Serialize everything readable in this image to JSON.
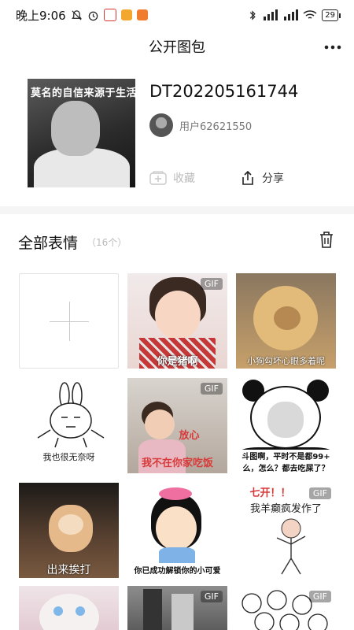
{
  "status": {
    "time": "晚上9:06",
    "battery": "29",
    "net1": "HD",
    "net2": "HD"
  },
  "header": {
    "title": "公开图包",
    "more": "···"
  },
  "pack": {
    "cover_caption": "莫名的自信来源于生活",
    "name": "DT202205161744",
    "user": "用户62621550",
    "favorite_label": "收藏",
    "share_label": "分享"
  },
  "section": {
    "title": "全部表情",
    "count": "（16个）"
  },
  "tiles": {
    "gif_label": "GIF",
    "t2_text": "你是猪啊",
    "t3_text": "小狗勾坏心眼多着呢",
    "t4_text": "我也很无奈呀",
    "t5_text1": "放心",
    "t5_text2": "我不在你家吃饭",
    "t6_text1": "斗图啊，平时不是都99+",
    "t6_text2": "么，怎么？都去吃屎了？",
    "t7_text": "出来挨打",
    "t8_text": "你已成功解锁你的小可爱",
    "t9_text1": "七开！！",
    "t9_text2": "我羊癫疯发作了"
  },
  "colors": {
    "accent_red": "#d83a3a",
    "divider": "#f5f5f5"
  }
}
